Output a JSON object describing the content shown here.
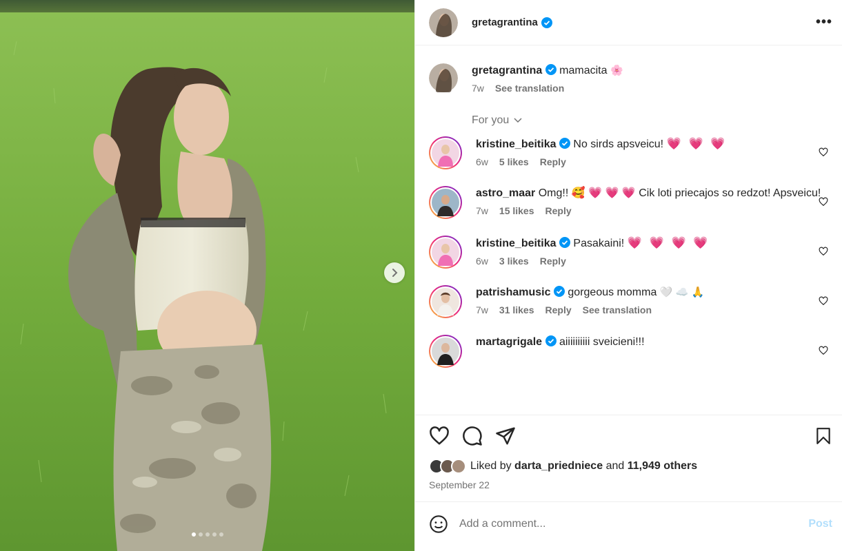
{
  "post": {
    "username": "gretagrantina",
    "more_label": "•••",
    "caption_text": "mamacita",
    "caption_emoji": "🌸",
    "caption_age": "7w",
    "see_translation": "See translation",
    "carousel_dots": 5,
    "carousel_active": 0
  },
  "for_you": "For you",
  "comments": [
    {
      "username": "kristine_beitika",
      "verified": true,
      "text": "No sirds apsveicu!",
      "emoji": "💗 💗 💗",
      "age": "6w",
      "likes": "5 likes",
      "reply": "Reply"
    },
    {
      "username": "astro_maar",
      "verified": false,
      "text": "Omg!! 🥰 💗 💗 💗 Cik loti priecajos so redzot! Apsveicu!",
      "age": "7w",
      "likes": "15 likes",
      "reply": "Reply"
    },
    {
      "username": "kristine_beitika",
      "verified": true,
      "text": "Pasakaini!",
      "emoji": "💗 💗 💗 💗",
      "age": "6w",
      "likes": "3 likes",
      "reply": "Reply"
    },
    {
      "username": "patrishamusic",
      "verified": true,
      "text": "gorgeous momma",
      "emoji": "🤍 ☁️ 🙏",
      "age": "7w",
      "likes": "31 likes",
      "reply": "Reply",
      "see_translation": "See translation"
    },
    {
      "username": "martagrigale",
      "verified": true,
      "text": "aiiiiiiiiii sveicieni!!!",
      "age": "",
      "likes": "",
      "reply": ""
    }
  ],
  "likes": {
    "prefix": "Liked by",
    "user": "darta_priedniece",
    "and": "and",
    "others": "11,949 others"
  },
  "date": "September 22",
  "add_comment": {
    "placeholder": "Add a comment...",
    "post_label": "Post"
  },
  "colors": {
    "verified": "#0095f6",
    "post_disabled": "#b2dffc",
    "secondary_text": "#737373"
  }
}
